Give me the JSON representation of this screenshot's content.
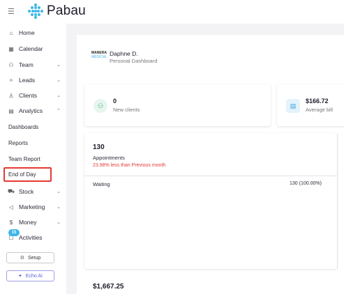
{
  "brand": {
    "name": "Pabau",
    "accent": "#3db6e8"
  },
  "sidebar": {
    "items": [
      {
        "label": "Home",
        "icon": "home-icon"
      },
      {
        "label": "Calendar",
        "icon": "calendar-icon"
      },
      {
        "label": "Team",
        "icon": "team-icon"
      },
      {
        "label": "Leads",
        "icon": "leads-icon"
      },
      {
        "label": "Clients",
        "icon": "clients-icon"
      },
      {
        "label": "Analytics",
        "icon": "analytics-icon"
      }
    ],
    "analytics_sub": [
      {
        "label": "Dashboards"
      },
      {
        "label": "Reports"
      },
      {
        "label": "Team Report"
      },
      {
        "label": "End of Day"
      }
    ],
    "items_after": [
      {
        "label": "Stock",
        "icon": "stock-icon"
      },
      {
        "label": "Marketing",
        "icon": "marketing-icon"
      },
      {
        "label": "Money",
        "icon": "money-icon"
      },
      {
        "label": "Activities",
        "icon": "activities-icon"
      }
    ],
    "activities_badge": "15",
    "setup_label": "Setup",
    "echo_label": "Echo AI"
  },
  "header": {
    "logo_line1": "MANERA",
    "logo_line2": "MEDICAL",
    "user_name": "Daphne D.",
    "subtitle": "Personal Dashboard"
  },
  "stats": [
    {
      "value": "0",
      "label": "New clients"
    },
    {
      "value": "$166.72",
      "label": "Average bill"
    }
  ],
  "appointments": {
    "count": "130",
    "label": "Appointments",
    "change": "23.98% less than Previous month",
    "row_label": "Waiting",
    "row_value": "130 (100.00%)"
  },
  "bottom_value": "$1,667.25"
}
